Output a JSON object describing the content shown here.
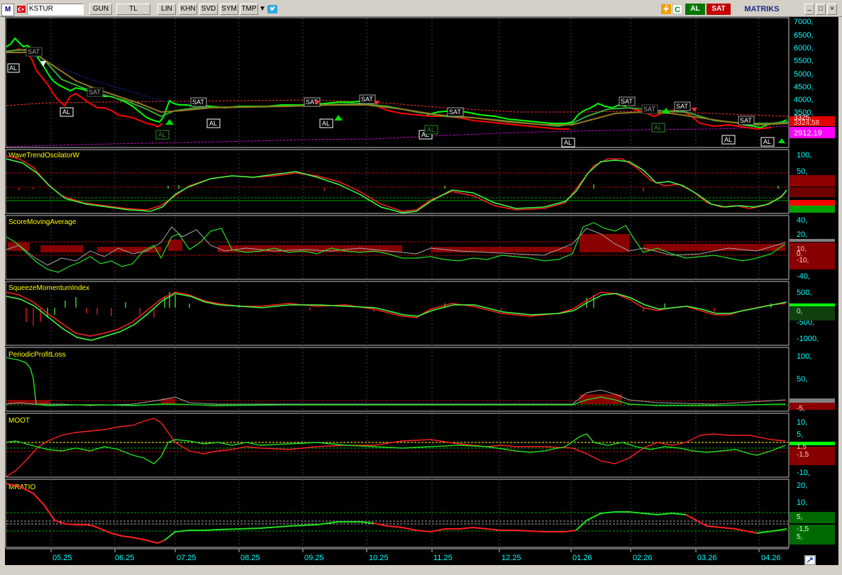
{
  "toolbar": {
    "app_logo": "M",
    "symbol": "KSTUR",
    "periods": [
      "GUN",
      "TL",
      "LIN",
      "KHN",
      "SVD",
      "SYM",
      "TMP"
    ],
    "buy_label": "AL",
    "sell_label": "SAT",
    "brand": "MATRIKS",
    "window_controls": [
      "_",
      "□",
      "×"
    ],
    "icons": [
      "flag-icon",
      "dropdown-arrow-icon",
      "twitter-icon",
      "lightning-icon",
      "refresh-icon"
    ]
  },
  "colors": {
    "background": "#000000",
    "up": "#00ff00",
    "down": "#ff0000",
    "label": "#ffff00",
    "axis": "#00ffff",
    "price_badge": "#ff00ff"
  },
  "main_chart": {
    "y_ticks": [
      "7000,",
      "6500,",
      "6000,",
      "5500,",
      "5000,",
      "4500,",
      "4000,",
      "3500,"
    ],
    "price_labels": [
      "3325,",
      "3324,58",
      "2912,19"
    ],
    "signals_al": [
      "AL",
      "AL",
      "AL",
      "AL",
      "AL",
      "AL",
      "AL",
      "AL",
      "AL",
      "AL",
      "AL",
      "AL"
    ],
    "signals_sat": [
      "SAT",
      "SAT",
      "SAT",
      "SAT",
      "SAT",
      "SAT",
      "SAT",
      "SAT",
      "SAT",
      "SAT",
      "SAT"
    ]
  },
  "panels": [
    {
      "title": "WaveTrendOscilatorW",
      "ticks": [
        "100,",
        "50,",
        "0,",
        "-50,"
      ]
    },
    {
      "title": "ScoreMovingAverage",
      "ticks": [
        "40,",
        "20,",
        "10,",
        "0,",
        "-10,",
        "-20,",
        "-40,"
      ]
    },
    {
      "title": "SqueezeMomentumIndex",
      "ticks": [
        "500,",
        "0,",
        "-500,",
        "-1000,"
      ]
    },
    {
      "title": "PeriodicProfitLoss",
      "ticks": [
        "100,",
        "50,",
        "-5,"
      ]
    },
    {
      "title": "MOOT",
      "ticks": [
        "10,",
        "5,",
        "1,5",
        "-1,5",
        "-10,"
      ]
    },
    {
      "title": "MRATIO",
      "ticks": [
        "20,",
        "10,",
        "5,",
        "-1,5",
        "5,"
      ]
    }
  ],
  "x_axis": [
    "05.25",
    "06.25",
    "07.25",
    "08.25",
    "09.25",
    "10.25",
    "11.25",
    "12.25",
    "01.26",
    "02.26",
    "03.26",
    "04.26"
  ]
}
